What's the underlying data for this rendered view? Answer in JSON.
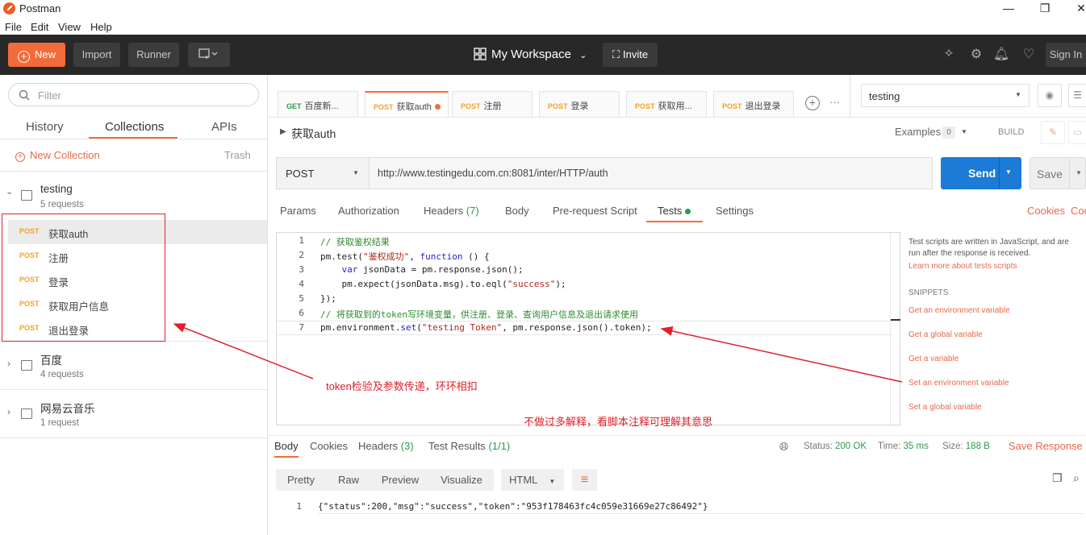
{
  "window": {
    "title": "Postman",
    "minimize": "—",
    "restore": "❐",
    "close": "✕"
  },
  "menu": [
    "File",
    "Edit",
    "View",
    "Help"
  ],
  "header": {
    "new": "New",
    "import": "Import",
    "runner": "Runner",
    "workspace": "My Workspace",
    "invite": "Invite",
    "sign_in": "Sign In"
  },
  "sidebar": {
    "filter_placeholder": "Filter",
    "tabs": [
      "History",
      "Collections",
      "APIs"
    ],
    "active_tab": "Collections",
    "new_collection": "New Collection",
    "trash": "Trash",
    "collections": [
      {
        "name": "testing",
        "count": "5 requests",
        "requests": [
          {
            "method": "POST",
            "name": "获取auth"
          },
          {
            "method": "POST",
            "name": "注册"
          },
          {
            "method": "POST",
            "name": "登录"
          },
          {
            "method": "POST",
            "name": "获取用户信息"
          },
          {
            "method": "POST",
            "name": "退出登录"
          }
        ]
      },
      {
        "name": "百度",
        "count": "4 requests"
      },
      {
        "name": "网易云音乐",
        "count": "1 request"
      }
    ]
  },
  "tabs": [
    {
      "method": "GET",
      "name": "百度新..."
    },
    {
      "method": "POST",
      "name": "获取auth"
    },
    {
      "method": "POST",
      "name": "注册"
    },
    {
      "method": "POST",
      "name": "登录"
    },
    {
      "method": "POST",
      "name": "获取用..."
    },
    {
      "method": "POST",
      "name": "退出登录"
    }
  ],
  "environment": "testing",
  "request": {
    "title": "获取auth",
    "examples": "Examples",
    "examples_count": "0",
    "build": "BUILD",
    "method": "POST",
    "url": "http://www.testingedu.com.cn:8081/inter/HTTP/auth",
    "send": "Send",
    "save": "Save",
    "tabs": {
      "params": "Params",
      "authorization": "Authorization",
      "headers": "Headers",
      "headers_count": "(7)",
      "body": "Body",
      "prerequest": "Pre-request Script",
      "tests": "Tests",
      "settings": "Settings"
    },
    "cookies": "Cookies",
    "code": "Cod"
  },
  "editor": {
    "line_numbers": [
      "1",
      "2",
      "3",
      "4",
      "5",
      "6",
      "7"
    ],
    "l1": "// 获取鉴权结果",
    "l2a": "pm.test(",
    "l2b": "\"鉴权成功\"",
    "l2c": ", ",
    "l2d": "function",
    "l2e": " () {",
    "l3a": "    ",
    "l3b": "var",
    "l3c": " jsonData = pm.response.json();",
    "l4a": "    pm.expect(jsonData.msg).to.eql(",
    "l4b": "\"success\"",
    "l4c": ");",
    "l5": "});",
    "l6": "// 将获取到的token写环境变量，供注册、登录、查询用户信息及退出请求使用",
    "l7a": "pm.environment.",
    "l7b": "set",
    "l7c": "(",
    "l7d": "\"testing Token\"",
    "l7e": ", pm.response.json().token);"
  },
  "right_panel": {
    "desc": "Test scripts are written in JavaScript, and are run after the response is received.",
    "learn": "Learn more about tests scripts",
    "snippets_title": "SNIPPETS",
    "snippets": [
      "Get an environment variable",
      "Get a global variable",
      "Get a variable",
      "Set an environment variable",
      "Set a global variable"
    ]
  },
  "annotations": {
    "a1": "token检验及参数传递，环环相扣",
    "a2": "不做过多解释，看脚本注释可理解其意思"
  },
  "response": {
    "tabs": {
      "body": "Body",
      "cookies": "Cookies",
      "headers": "Headers",
      "headers_count": "(3)",
      "tests": "Test Results",
      "tests_count": "(1/1)"
    },
    "status_label": "Status:",
    "status": "200 OK",
    "time_label": "Time:",
    "time": "35 ms",
    "size_label": "Size:",
    "size": "188 B",
    "save_response": "Save Response",
    "views": [
      "Pretty",
      "Raw",
      "Preview",
      "Visualize"
    ],
    "format": "HTML",
    "line": "1",
    "body": "{\"status\":200,\"msg\":\"success\",\"token\":\"953f178463fc4c059e31669e27c86492\"}"
  },
  "colors": {
    "accent": "#f26b3a",
    "send": "#1b7bd6",
    "header_bg": "#282828",
    "annotation": "#e0202a",
    "post": "#f0a22b"
  }
}
